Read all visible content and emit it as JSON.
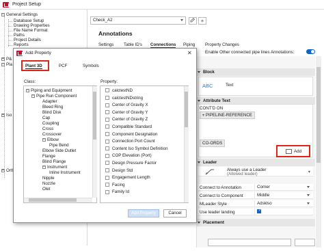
{
  "window": {
    "title": "Project Setup"
  },
  "tree": {
    "items": [
      "General Settings",
      "Database Setup",
      "Drawing Properties",
      "File Name Format",
      "Paths",
      "Project Details",
      "Reports"
    ],
    "truncated": [
      "P&",
      "Pla",
      "Iso",
      "Ortl"
    ]
  },
  "header": {
    "combo_value": "Check_A2",
    "add_symbol": "+",
    "section_title": "Annotations"
  },
  "tabs": [
    "Settings",
    "Table ID's",
    "Connections",
    "Piping",
    "Property Changes"
  ],
  "active_tab": "Connections",
  "toggle": {
    "label": "Enable Other connected pipe lines Annotations:",
    "on": true
  },
  "block": {
    "header": "Block",
    "icon_text": "ABC",
    "text": "Text"
  },
  "attribute_text": {
    "header": "Attribute Text",
    "cont_label": "CONT'D ON",
    "chip_pipeline": "PIPELINE-REFERENCE",
    "chip_coords": "CO-ORDS",
    "add_label": "Add"
  },
  "leader": {
    "header": "Leader",
    "style_value": "Always use a Leader",
    "style_sub": "(Allowed leader)",
    "rows": [
      {
        "key": "Connect to Annotation",
        "value": "Corner"
      },
      {
        "key": "Connect to Component",
        "value": "Middle"
      },
      {
        "key": "MLeader Style",
        "value": "Adsklso"
      },
      {
        "key": "Use leader landing",
        "value": ""
      }
    ],
    "use_landing": true
  },
  "placement": {
    "header": "Placement"
  },
  "dialog": {
    "title": "Add Property",
    "close": "✕",
    "tabs": [
      "Plant 3D",
      "PCF",
      "Symbols"
    ],
    "class_label": "Class:",
    "property_label": "Property:",
    "classes": [
      {
        "text": "Piping and Equipment",
        "level": 0,
        "exp": "-"
      },
      {
        "text": "Pipe Run Component",
        "level": 1,
        "exp": "-"
      },
      {
        "text": "Adapter",
        "level": 2,
        "exp": ""
      },
      {
        "text": "Bleed Ring",
        "level": 2,
        "exp": ""
      },
      {
        "text": "Blind Disk",
        "level": 2,
        "exp": ""
      },
      {
        "text": "Cap",
        "level": 2,
        "exp": ""
      },
      {
        "text": "Coupling",
        "level": 2,
        "exp": ""
      },
      {
        "text": "Cross",
        "level": 2,
        "exp": ""
      },
      {
        "text": "Crossover",
        "level": 2,
        "exp": ""
      },
      {
        "text": "Elbow",
        "level": 2,
        "exp": "-"
      },
      {
        "text": "Pipe Bend",
        "level": 3,
        "exp": ""
      },
      {
        "text": "Elbow Side Outlet",
        "level": 2,
        "exp": ""
      },
      {
        "text": "Flange",
        "level": 2,
        "exp": ""
      },
      {
        "text": "Blind Flange",
        "level": 2,
        "exp": ""
      },
      {
        "text": "Instrument",
        "level": 2,
        "exp": "-"
      },
      {
        "text": "Inline Instrument",
        "level": 3,
        "exp": ""
      },
      {
        "text": "Nipple",
        "level": 2,
        "exp": ""
      },
      {
        "text": "Nozzle",
        "level": 2,
        "exp": ""
      },
      {
        "text": "Olet",
        "level": 2,
        "exp": ""
      }
    ],
    "properties": [
      "calctestND",
      "calctestNDstring",
      "Center of Gravity X",
      "Center of Gravity Y",
      "Center of Gravity Z",
      "Compatible Standard",
      "Component Designation",
      "Connection Port Count",
      "Content Iso Symbol Definition",
      "COP Elevation (Port)",
      "Design Pressure Factor",
      "Design Std",
      "Engagement Length",
      "Facing",
      "Family Id"
    ],
    "add_button": "Add Property",
    "cancel_button": "Cancel"
  }
}
